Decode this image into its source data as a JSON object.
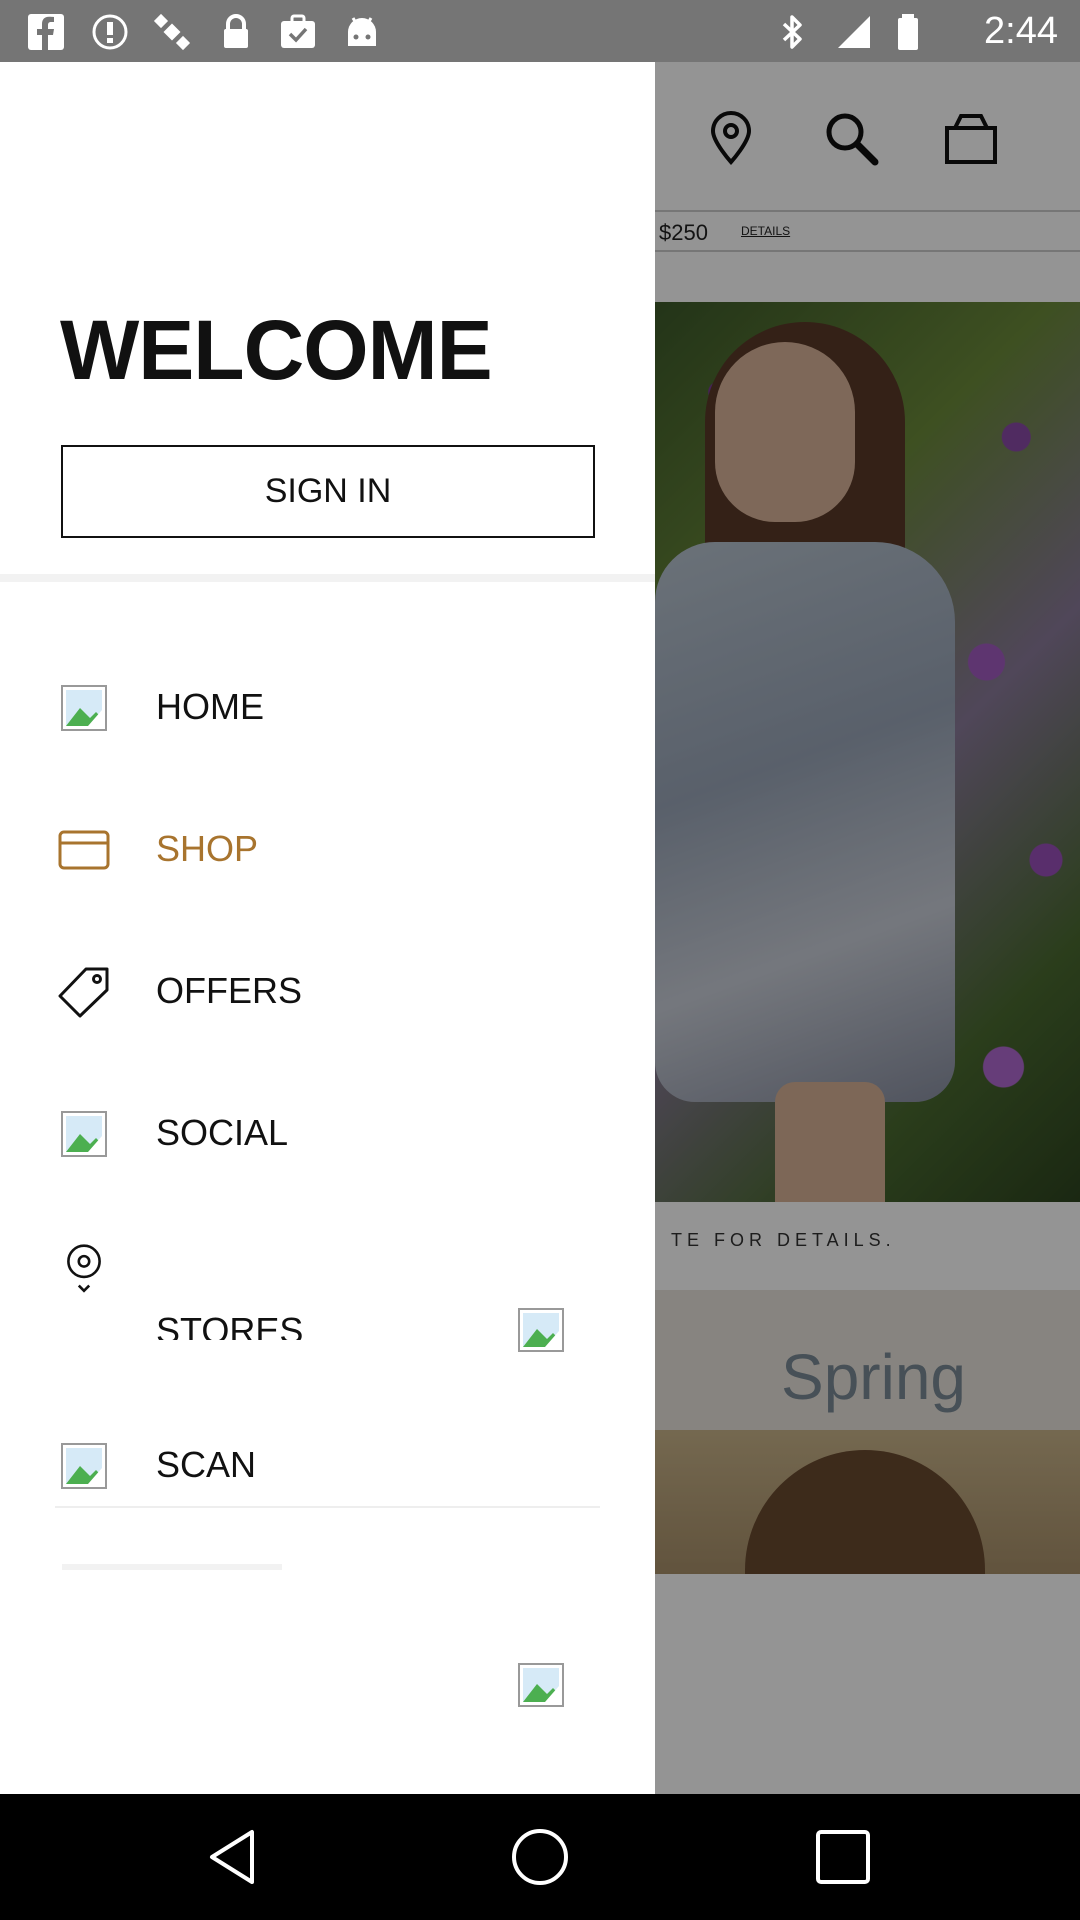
{
  "status_bar": {
    "time": "2:44",
    "left_icons": [
      "facebook-icon",
      "alert-icon",
      "satellite-icon",
      "lock-icon",
      "clipboard-check-icon",
      "android-icon"
    ],
    "right_icons": [
      "bluetooth-icon",
      "signal-icon",
      "battery-icon"
    ]
  },
  "background_app": {
    "toolbar_icons": [
      "location-pin-icon",
      "search-icon",
      "shopping-bag-icon"
    ],
    "promo_price": "$250",
    "promo_details": "DETAILS",
    "banner_caption": "TE FOR DETAILS.",
    "banner2_text": "Spring"
  },
  "drawer": {
    "welcome": "WELCOME",
    "sign_in": "SIGN IN",
    "items": [
      {
        "label": "HOME",
        "icon": "broken-image-icon"
      },
      {
        "label": "SHOP",
        "icon": "credit-card-icon"
      },
      {
        "label": "OFFERS",
        "icon": "tag-icon"
      },
      {
        "label": "SOCIAL",
        "icon": "broken-image-icon"
      },
      {
        "label": "STORES",
        "icon": "location-pin-icon"
      },
      {
        "label": "SCAN",
        "icon": "broken-image-icon"
      }
    ],
    "active_color": "#a8742e"
  },
  "nav_bar": {
    "buttons": [
      "back-icon",
      "home-icon",
      "recents-icon"
    ]
  }
}
